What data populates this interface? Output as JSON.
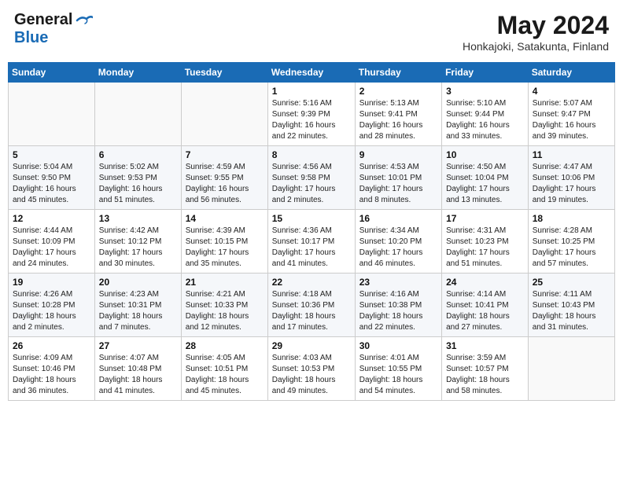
{
  "header": {
    "logo_line1": "General",
    "logo_line2": "Blue",
    "month": "May 2024",
    "location": "Honkajoki, Satakunta, Finland"
  },
  "weekdays": [
    "Sunday",
    "Monday",
    "Tuesday",
    "Wednesday",
    "Thursday",
    "Friday",
    "Saturday"
  ],
  "weeks": [
    [
      {
        "day": "",
        "info": ""
      },
      {
        "day": "",
        "info": ""
      },
      {
        "day": "",
        "info": ""
      },
      {
        "day": "1",
        "info": "Sunrise: 5:16 AM\nSunset: 9:39 PM\nDaylight: 16 hours\nand 22 minutes."
      },
      {
        "day": "2",
        "info": "Sunrise: 5:13 AM\nSunset: 9:41 PM\nDaylight: 16 hours\nand 28 minutes."
      },
      {
        "day": "3",
        "info": "Sunrise: 5:10 AM\nSunset: 9:44 PM\nDaylight: 16 hours\nand 33 minutes."
      },
      {
        "day": "4",
        "info": "Sunrise: 5:07 AM\nSunset: 9:47 PM\nDaylight: 16 hours\nand 39 minutes."
      }
    ],
    [
      {
        "day": "5",
        "info": "Sunrise: 5:04 AM\nSunset: 9:50 PM\nDaylight: 16 hours\nand 45 minutes."
      },
      {
        "day": "6",
        "info": "Sunrise: 5:02 AM\nSunset: 9:53 PM\nDaylight: 16 hours\nand 51 minutes."
      },
      {
        "day": "7",
        "info": "Sunrise: 4:59 AM\nSunset: 9:55 PM\nDaylight: 16 hours\nand 56 minutes."
      },
      {
        "day": "8",
        "info": "Sunrise: 4:56 AM\nSunset: 9:58 PM\nDaylight: 17 hours\nand 2 minutes."
      },
      {
        "day": "9",
        "info": "Sunrise: 4:53 AM\nSunset: 10:01 PM\nDaylight: 17 hours\nand 8 minutes."
      },
      {
        "day": "10",
        "info": "Sunrise: 4:50 AM\nSunset: 10:04 PM\nDaylight: 17 hours\nand 13 minutes."
      },
      {
        "day": "11",
        "info": "Sunrise: 4:47 AM\nSunset: 10:06 PM\nDaylight: 17 hours\nand 19 minutes."
      }
    ],
    [
      {
        "day": "12",
        "info": "Sunrise: 4:44 AM\nSunset: 10:09 PM\nDaylight: 17 hours\nand 24 minutes."
      },
      {
        "day": "13",
        "info": "Sunrise: 4:42 AM\nSunset: 10:12 PM\nDaylight: 17 hours\nand 30 minutes."
      },
      {
        "day": "14",
        "info": "Sunrise: 4:39 AM\nSunset: 10:15 PM\nDaylight: 17 hours\nand 35 minutes."
      },
      {
        "day": "15",
        "info": "Sunrise: 4:36 AM\nSunset: 10:17 PM\nDaylight: 17 hours\nand 41 minutes."
      },
      {
        "day": "16",
        "info": "Sunrise: 4:34 AM\nSunset: 10:20 PM\nDaylight: 17 hours\nand 46 minutes."
      },
      {
        "day": "17",
        "info": "Sunrise: 4:31 AM\nSunset: 10:23 PM\nDaylight: 17 hours\nand 51 minutes."
      },
      {
        "day": "18",
        "info": "Sunrise: 4:28 AM\nSunset: 10:25 PM\nDaylight: 17 hours\nand 57 minutes."
      }
    ],
    [
      {
        "day": "19",
        "info": "Sunrise: 4:26 AM\nSunset: 10:28 PM\nDaylight: 18 hours\nand 2 minutes."
      },
      {
        "day": "20",
        "info": "Sunrise: 4:23 AM\nSunset: 10:31 PM\nDaylight: 18 hours\nand 7 minutes."
      },
      {
        "day": "21",
        "info": "Sunrise: 4:21 AM\nSunset: 10:33 PM\nDaylight: 18 hours\nand 12 minutes."
      },
      {
        "day": "22",
        "info": "Sunrise: 4:18 AM\nSunset: 10:36 PM\nDaylight: 18 hours\nand 17 minutes."
      },
      {
        "day": "23",
        "info": "Sunrise: 4:16 AM\nSunset: 10:38 PM\nDaylight: 18 hours\nand 22 minutes."
      },
      {
        "day": "24",
        "info": "Sunrise: 4:14 AM\nSunset: 10:41 PM\nDaylight: 18 hours\nand 27 minutes."
      },
      {
        "day": "25",
        "info": "Sunrise: 4:11 AM\nSunset: 10:43 PM\nDaylight: 18 hours\nand 31 minutes."
      }
    ],
    [
      {
        "day": "26",
        "info": "Sunrise: 4:09 AM\nSunset: 10:46 PM\nDaylight: 18 hours\nand 36 minutes."
      },
      {
        "day": "27",
        "info": "Sunrise: 4:07 AM\nSunset: 10:48 PM\nDaylight: 18 hours\nand 41 minutes."
      },
      {
        "day": "28",
        "info": "Sunrise: 4:05 AM\nSunset: 10:51 PM\nDaylight: 18 hours\nand 45 minutes."
      },
      {
        "day": "29",
        "info": "Sunrise: 4:03 AM\nSunset: 10:53 PM\nDaylight: 18 hours\nand 49 minutes."
      },
      {
        "day": "30",
        "info": "Sunrise: 4:01 AM\nSunset: 10:55 PM\nDaylight: 18 hours\nand 54 minutes."
      },
      {
        "day": "31",
        "info": "Sunrise: 3:59 AM\nSunset: 10:57 PM\nDaylight: 18 hours\nand 58 minutes."
      },
      {
        "day": "",
        "info": ""
      }
    ]
  ]
}
